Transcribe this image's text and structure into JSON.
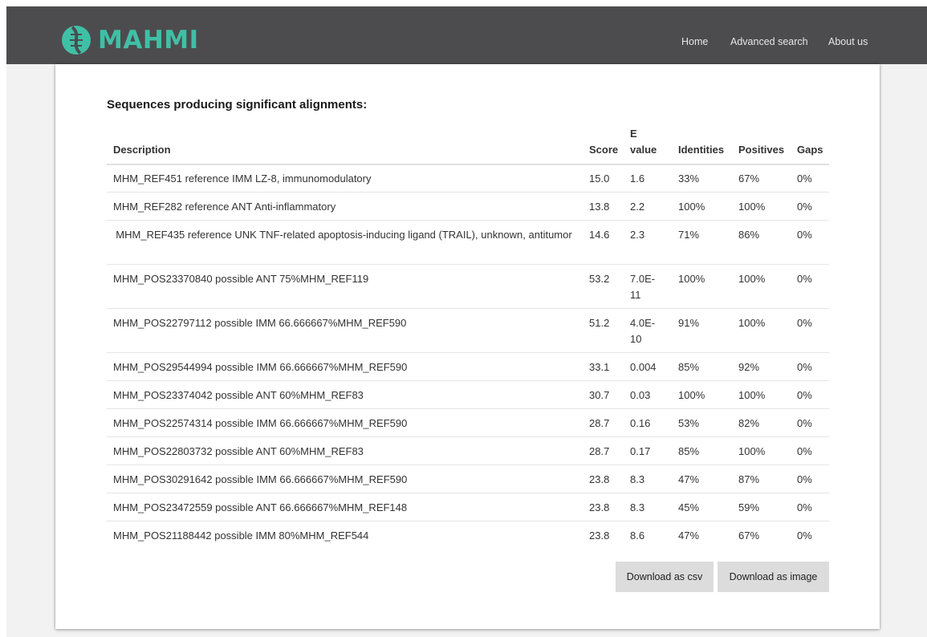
{
  "nav": {
    "brand": "MAHMI",
    "links": [
      "Home",
      "Advanced search",
      "About us"
    ]
  },
  "title": "Sequences producing significant alignments:",
  "table": {
    "headers": {
      "description": "Description",
      "score": "Score",
      "evalue": "E value",
      "identities": "Identities",
      "positives": "Positives",
      "gaps": "Gaps"
    },
    "rows": [
      {
        "description": "MHM_REF451 reference IMM LZ-8, immunomodulatory",
        "score": "15.0",
        "evalue": "1.6",
        "identities": "33%",
        "positives": "67%",
        "gaps": "0%"
      },
      {
        "description": "MHM_REF282 reference ANT Anti-inflammatory",
        "score": "13.8",
        "evalue": "2.2",
        "identities": "100%",
        "positives": "100%",
        "gaps": "0%"
      },
      {
        "description": "MHM_REF435 reference UNK TNF-related apoptosis-inducing ligand (TRAIL), unknown, antitumor",
        "score": "14.6",
        "evalue": "2.3",
        "identities": "71%",
        "positives": "86%",
        "gaps": "0%"
      },
      {
        "description": "MHM_POS23370840 possible ANT 75%MHM_REF119",
        "score": "53.2",
        "evalue": "7.0E-11",
        "identities": "100%",
        "positives": "100%",
        "gaps": "0%"
      },
      {
        "description": "MHM_POS22797112 possible IMM 66.666667%MHM_REF590",
        "score": "51.2",
        "evalue": "4.0E-10",
        "identities": "91%",
        "positives": "100%",
        "gaps": "0%"
      },
      {
        "description": "MHM_POS29544994 possible IMM 66.666667%MHM_REF590",
        "score": "33.1",
        "evalue": "0.004",
        "identities": "85%",
        "positives": "92%",
        "gaps": "0%"
      },
      {
        "description": "MHM_POS23374042 possible ANT 60%MHM_REF83",
        "score": "30.7",
        "evalue": "0.03",
        "identities": "100%",
        "positives": "100%",
        "gaps": "0%"
      },
      {
        "description": "MHM_POS22574314 possible IMM 66.666667%MHM_REF590",
        "score": "28.7",
        "evalue": "0.16",
        "identities": "53%",
        "positives": "82%",
        "gaps": "0%"
      },
      {
        "description": "MHM_POS22803732 possible ANT 60%MHM_REF83",
        "score": "28.7",
        "evalue": "0.17",
        "identities": "85%",
        "positives": "100%",
        "gaps": "0%"
      },
      {
        "description": "MHM_POS30291642 possible IMM 66.666667%MHM_REF590",
        "score": "23.8",
        "evalue": "8.3",
        "identities": "47%",
        "positives": "87%",
        "gaps": "0%"
      },
      {
        "description": "MHM_POS23472559 possible ANT 66.666667%MHM_REF148",
        "score": "23.8",
        "evalue": "8.3",
        "identities": "45%",
        "positives": "59%",
        "gaps": "0%"
      },
      {
        "description": "MHM_POS21188442 possible IMM 80%MHM_REF544",
        "score": "23.8",
        "evalue": "8.6",
        "identities": "47%",
        "positives": "67%",
        "gaps": "0%"
      }
    ]
  },
  "buttons": {
    "csv": "Download as csv",
    "image": "Download as image"
  },
  "colors": {
    "navbar": "#4c4c4e",
    "brand": "#3fc0a6",
    "button": "#dcdcdc"
  }
}
